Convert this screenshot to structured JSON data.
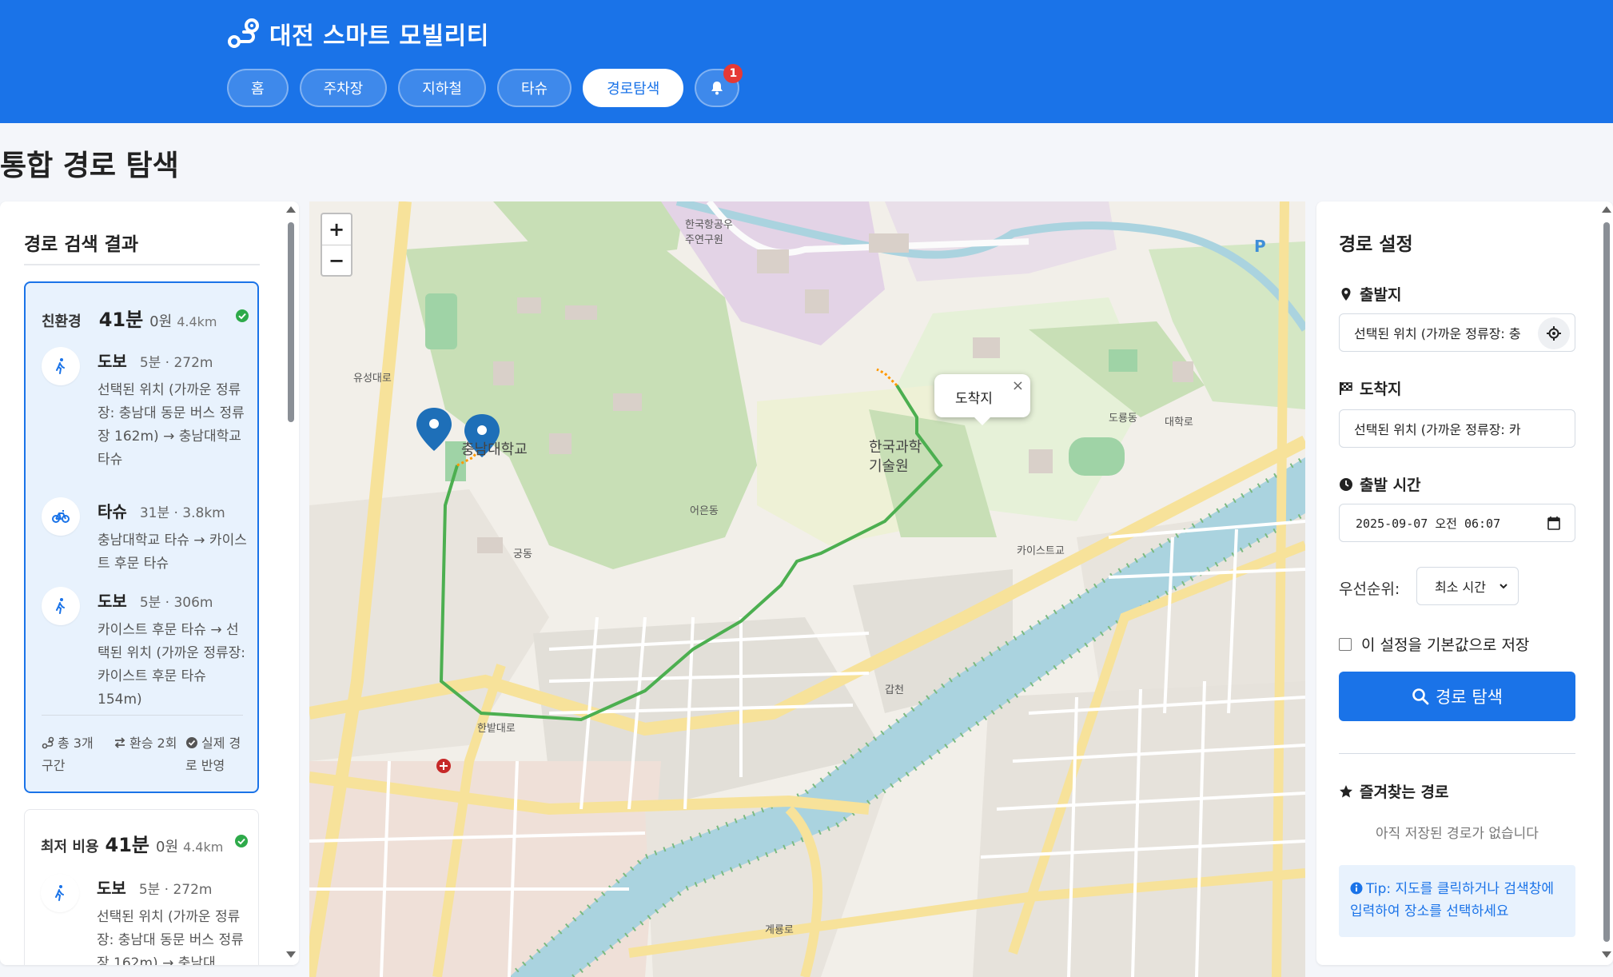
{
  "header": {
    "title": "대전 스마트 모빌리티",
    "nav": [
      "홈",
      "주차장",
      "지하철",
      "타슈",
      "경로탐색"
    ],
    "active_nav": "경로탐색",
    "notification_count": "1",
    "brand_color": "#1a73e8"
  },
  "page_title": "통합 경로 탐색",
  "results": {
    "title": "경로 검색 결과",
    "routes": [
      {
        "label": "친환경",
        "time": "41분",
        "cost": "0원",
        "distance": "4.4km",
        "segments": [
          {
            "mode": "도보",
            "meta": "5분 · 272m",
            "desc": "선택된 위치 (가까운 정류장: 충남대 동문 버스 정류장 162m) → 충남대학교 타슈",
            "icon": "walk-icon"
          },
          {
            "mode": "타슈",
            "meta": "31분 · 3.8km",
            "desc": "충남대학교 타슈 → 카이스트 후문 타슈",
            "icon": "bike-icon"
          },
          {
            "mode": "도보",
            "meta": "5분 · 306m",
            "desc": "카이스트 후문 타슈 → 선택된 위치 (가까운 정류장: 카이스트 후문 타슈 154m)",
            "icon": "walk-icon"
          }
        ],
        "footer": [
          "총 3개 구간",
          "환승 2회",
          "실제 경로 반영"
        ]
      },
      {
        "label": "최저 비용",
        "time": "41분",
        "cost": "0원",
        "distance": "4.4km",
        "segments": [
          {
            "mode": "도보",
            "meta": "5분 · 272m",
            "desc": "선택된 위치 (가까운 정류장: 충남대 동문 버스 정류장 162m) → 충남대",
            "icon": "walk-icon"
          }
        ]
      }
    ]
  },
  "map": {
    "zoom_in": "+",
    "zoom_out": "−",
    "popup_text": "도착지",
    "popup_close": "×",
    "route_color": "#4caf50",
    "marker_color": "#1e6fb8",
    "labels": {
      "cnu": "충남대학교",
      "kaist": "한국과학기술원",
      "eoeun": "어은동",
      "kaist_gate": "카이스트교",
      "gapcheon": "갑천",
      "gungdong": "궁동",
      "hanbat": "한밭대로",
      "daehak": "대학로",
      "gyeryong": "계룡로",
      "yuseong": "유성대로",
      "doryong": "도룡동",
      "kari": "한국항공우주연구원"
    }
  },
  "settings": {
    "title": "경로 설정",
    "origin_label": "출발지",
    "origin_value": "선택된 위치 (가까운 정류장: 충",
    "dest_label": "도착지",
    "dest_value": "선택된 위치 (가까운 정류장: 카",
    "time_label": "출발 시간",
    "time_value": "2025-09-07  오전  06:07",
    "priority_label": "우선순위:",
    "priority_value": "최소 시간",
    "save_default_label": "이 설정을 기본값으로 저장",
    "search_button": "경로 탐색",
    "favorites_title": "즐겨찾는 경로",
    "favorites_empty": "아직 저장된 경로가 없습니다",
    "tip": "Tip: 지도를 클릭하거나 검색창에 입력하여 장소를 선택하세요"
  }
}
